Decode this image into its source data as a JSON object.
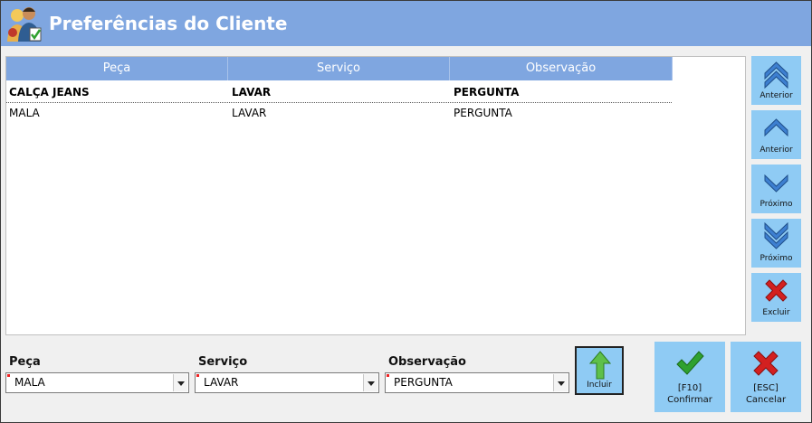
{
  "window": {
    "title": "Preferências do Cliente"
  },
  "grid": {
    "columns": [
      "Peça",
      "Serviço",
      "Observação"
    ],
    "rows": [
      [
        "CALÇA JEANS",
        "LAVAR",
        "PERGUNTA"
      ],
      [
        "MALA",
        "LAVAR",
        "PERGUNTA"
      ]
    ]
  },
  "nav": {
    "first_label": "Anterior",
    "prev_label": "Anterior",
    "next_label": "Próximo",
    "last_label": "Próximo",
    "delete_label": "Excluir"
  },
  "form": {
    "peca": {
      "label": "Peça",
      "value": "MALA"
    },
    "servico": {
      "label": "Serviço",
      "value": "LAVAR"
    },
    "observacao": {
      "label": "Observação",
      "value": "PERGUNTA"
    },
    "incluir_label": "Incluir"
  },
  "actions": {
    "confirm_key": "[F10]",
    "confirm_label": "Confirmar",
    "cancel_key": "[ESC]",
    "cancel_label": "Cancelar"
  },
  "colors": {
    "titlebar": "#7fa6e0",
    "button_bg": "#8fcbf4",
    "nav_arrow": "#3d7fd0",
    "confirm_green": "#2fa12f",
    "cancel_red": "#d32020"
  },
  "icons": {
    "title": "customer-preferences-icon",
    "first": "double-chevron-up-icon",
    "prev": "chevron-up-icon",
    "next": "chevron-down-icon",
    "last": "double-chevron-down-icon",
    "delete": "red-x-icon",
    "incluir": "green-up-arrow-icon",
    "confirm": "green-check-icon",
    "cancel": "red-x-icon"
  }
}
